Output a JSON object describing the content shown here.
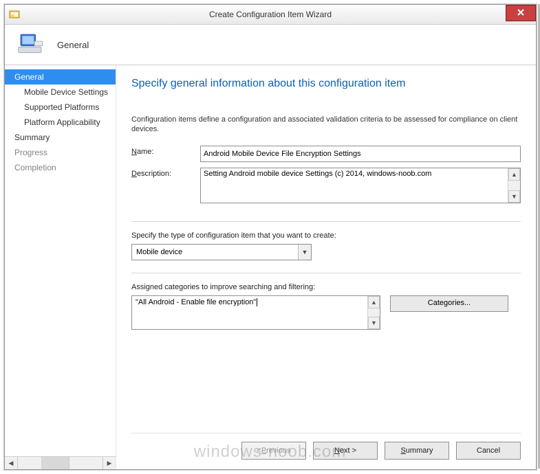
{
  "window": {
    "title": "Create Configuration Item Wizard"
  },
  "header": {
    "section": "General"
  },
  "sidebar": {
    "items": [
      {
        "label": "General",
        "selected": true,
        "sub": false,
        "dim": false
      },
      {
        "label": "Mobile Device Settings",
        "selected": false,
        "sub": true,
        "dim": false
      },
      {
        "label": "Supported Platforms",
        "selected": false,
        "sub": true,
        "dim": false
      },
      {
        "label": "Platform Applicability",
        "selected": false,
        "sub": true,
        "dim": false
      },
      {
        "label": "Summary",
        "selected": false,
        "sub": false,
        "dim": false
      },
      {
        "label": "Progress",
        "selected": false,
        "sub": false,
        "dim": true
      },
      {
        "label": "Completion",
        "selected": false,
        "sub": false,
        "dim": true
      }
    ]
  },
  "content": {
    "heading": "Specify general information about this configuration item",
    "intro": "Configuration items define a configuration and associated validation criteria to be assessed for compliance on client devices.",
    "name_label_prefix": "N",
    "name_label_rest": "ame:",
    "name_value": "Android Mobile Device File Encryption Settings",
    "desc_label_prefix": "D",
    "desc_label_rest": "escription:",
    "desc_value": "Setting Android mobile device Settings (c) 2014, windows-noob.com",
    "type_label": "Specify the type of configuration item that you want to create:",
    "type_value": "Mobile device",
    "cat_label": "Assigned categories to improve searching and filtering:",
    "cat_value": "\"All Android - Enable file encryption\"",
    "cat_button_prefix": "C",
    "cat_button_rest": "ategories..."
  },
  "footer": {
    "previous_prefix": "P",
    "previous_rest": "revious",
    "next_prefix": "N",
    "next_rest": "ext >",
    "summary_prefix": "S",
    "summary_rest": "ummary",
    "cancel": "Cancel"
  },
  "watermark": "windows-noob.com"
}
